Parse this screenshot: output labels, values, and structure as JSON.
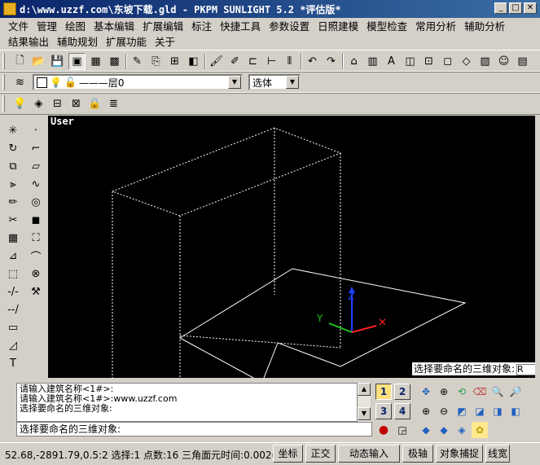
{
  "window": {
    "title": "d:\\www.uzzf.com\\东坡下载.gld - PKPM SUNLIGHT 5.2 *评估版*"
  },
  "menu": {
    "row1": [
      "文件",
      "管理",
      "绘图",
      "基本编辑",
      "扩展编辑",
      "标注",
      "快捷工具",
      "参数设置",
      "日照建模",
      "模型检查",
      "常用分析",
      "辅助分析"
    ],
    "row2": [
      "结果输出",
      "辅助规划",
      "扩展功能",
      "关于"
    ]
  },
  "layerbar": {
    "layer_value": "———层0",
    "select_mode": "选体"
  },
  "viewport": {
    "label": "User"
  },
  "prompt_tooltip": {
    "text": "选择要命名的三维对象:",
    "cursor_char": "R"
  },
  "command": {
    "history": [
      "请输入建筑名称<1#>:",
      "请输入建筑名称<1#>:www.uzzf.com",
      "选择要命名的三维对象:"
    ],
    "input_text": "选择要命名的三维对象:"
  },
  "view_buttons": [
    "1",
    "2",
    "3",
    "4"
  ],
  "statusbar": {
    "text": "52.68,-2891.79,0.5:2 选择:1 点数:16 三角面元时间:0.002(",
    "buttons": [
      "坐标",
      "正交",
      "动态输入",
      "极轴",
      "对象捕捉",
      "线宽"
    ]
  },
  "colors": {
    "title_bg": "#0a246a",
    "viewport_bg": "#000000",
    "axis_x": "#ff2020",
    "axis_y": "#20c020",
    "axis_z": "#2040ff"
  }
}
